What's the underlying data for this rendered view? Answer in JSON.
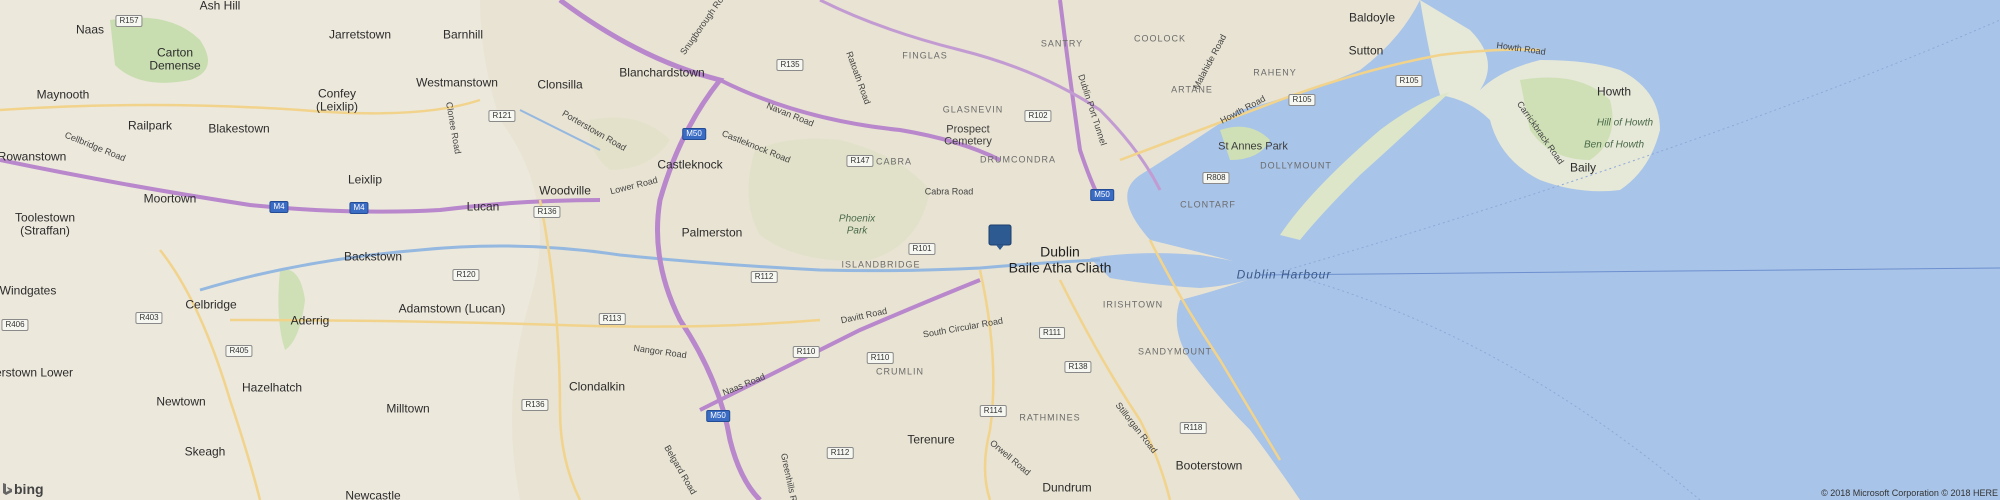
{
  "map": {
    "region": "Dublin",
    "pin_icon": "map-pin-icon",
    "brand": "bing",
    "copyright": "© 2018 Microsoft Corporation © 2018 HERE"
  },
  "places": {
    "naas": "Naas",
    "ash_hill": "Ash Hill",
    "carton_demesne_1": "Carton",
    "carton_demesne_2": "Demense",
    "jarretstown": "Jarretstown",
    "barnhill": "Barnhill",
    "maynooth": "Maynooth",
    "confey_1": "Confey",
    "confey_2": "(Leixlip)",
    "westmanstown": "Westmanstown",
    "clonsilla": "Clonsilla",
    "blanchardstown": "Blanchardstown",
    "railpark": "Railpark",
    "blakestown": "Blakestown",
    "rowanstown": "Rowanstown",
    "castleknock": "Castleknock",
    "leixlip": "Leixlip",
    "mortown": "Moortown",
    "lucan": "Lucan",
    "woodville": "Woodville",
    "toolestown_1": "Toolestown",
    "toolestown_2": "(Straffan)",
    "palmerston": "Palmerston",
    "backstown": "Backstown",
    "windgates": "Windgates",
    "celbridge": "Celbridge",
    "aderrig": "Aderrig",
    "adamstown": "Adamstown (Lucan)",
    "erstown_lower": "erstown Lower",
    "hazelhatch": "Hazelhatch",
    "clondalkin": "Clondalkin",
    "newtown": "Newtown",
    "milltown": "Milltown",
    "skeagh": "Skeagh",
    "newcastle": "Newcastle",
    "dublin": "Dublin",
    "baile_atha_cliath": "Baile Atha Cliath",
    "terenure": "Terenure",
    "dundrum": "Dundrum",
    "booterstown": "Booterstown",
    "baldoyle": "Baldoyle",
    "sutton": "Sutton",
    "howth": "Howth",
    "baily": "Baily",
    "st_annes_park": "St Annes Park",
    "prospect_cemetery_1": "Prospect",
    "prospect_cemetery_2": "Cemetery",
    "phoenix_park_1": "Phoenix",
    "phoenix_park_2": "Park",
    "hill_of_howth": "Hill of Howth",
    "ben_of_howth": "Ben of Howth"
  },
  "districts": {
    "finglas": "FINGLAS",
    "santry": "SANTRY",
    "coolock": "COOLOCK",
    "artane": "ARTANE",
    "raheny": "RAHENY",
    "glasnevin": "GLASNEVIN",
    "drumcondra": "DRUMCONDRA",
    "cabra": "CABRA",
    "dollymount": "DOLLYMOUNT",
    "clontarf": "CLONTARF",
    "islandbridge": "ISLANDBRIDGE",
    "irishtown": "IRISHTOWN",
    "sandymount": "SANDYMOUNT",
    "rathmines": "RATHMINES",
    "crumlin": "CRUMLIN"
  },
  "roads": {
    "navan_road": "Navan Road",
    "castleknock_road": "Castleknock Road",
    "cabra_road": "Cabra Road",
    "porterstown_road": "Porterstown Road",
    "lower_road": "Lower Road",
    "cellbridge_road": "Cellbridge Road",
    "ratoath_road": "Ratoath Road",
    "howth_road_1": "Howth Road",
    "howth_road_2": "Howth Road",
    "malahide_road": "Malahide Road",
    "dublin_port_tunnel": "Dublin Port Tunnel",
    "davitt_road": "Davitt Road",
    "nangor_road": "Nangor Road",
    "naas_road": "Naas Road",
    "south_circular_road": "South Circular Road",
    "belgard_road": "Belgard Road",
    "greenhills_road": "Greenhills Road",
    "orwell_road": "Orwell Road",
    "stillorgan_road": "Stillorgan Road",
    "carrickbrack_road": "Carrickbrack Road",
    "clonee_road": "Clonee Road",
    "snugborough_road": "Snugborough Road"
  },
  "water": {
    "dublin_harbour": "Dublin Harbour"
  },
  "route_shields": {
    "r157": "R157",
    "r135": "R135",
    "r121": "R121",
    "m50_a": "M50",
    "r147": "R147",
    "r102": "R102",
    "r105_a": "R105",
    "r105_b": "R105",
    "m4_a": "M4",
    "m4_b": "M4",
    "r136": "R136",
    "r808": "R808",
    "m50_b": "M50",
    "r101": "R101",
    "r120": "R120",
    "r112_a": "R112",
    "r403": "R403",
    "r113": "R113",
    "r406": "R406",
    "r405": "R405",
    "r110_a": "R110",
    "r111": "R111",
    "r110_b": "R110",
    "r138": "R138",
    "r136_b": "R136",
    "m50_c": "M50",
    "r114": "R114",
    "r118": "R118",
    "r112_b": "R112"
  }
}
